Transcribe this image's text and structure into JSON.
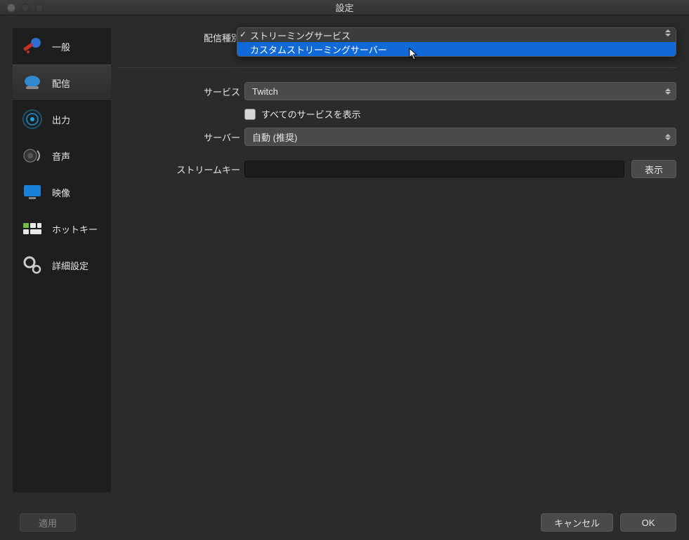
{
  "window": {
    "title": "設定"
  },
  "sidebar": {
    "items": [
      {
        "label": "一般"
      },
      {
        "label": "配信"
      },
      {
        "label": "出力"
      },
      {
        "label": "音声"
      },
      {
        "label": "映像"
      },
      {
        "label": "ホットキー"
      },
      {
        "label": "詳細設定"
      }
    ]
  },
  "form": {
    "stream_type_label": "配信種別",
    "stream_type_options": {
      "selected": "ストリーミングサービス",
      "highlighted": "カスタムストリーミングサーバー"
    },
    "service_label": "サービス",
    "service_value": "Twitch",
    "show_all_label": "すべてのサービスを表示",
    "server_label": "サーバー",
    "server_value": "自動 (推奨)",
    "streamkey_label": "ストリームキー",
    "streamkey_value": "",
    "show_button": "表示"
  },
  "footer": {
    "apply": "適用",
    "cancel": "キャンセル",
    "ok": "OK"
  }
}
